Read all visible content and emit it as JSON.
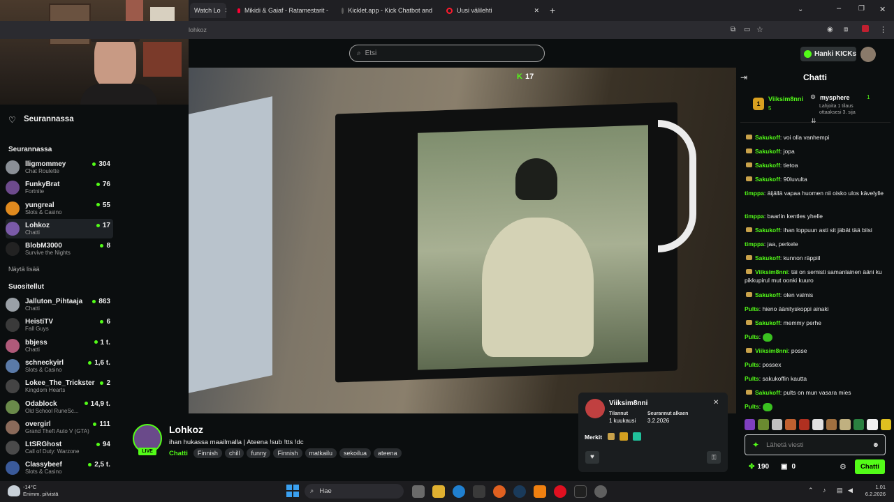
{
  "browser": {
    "tabs": [
      {
        "label": "Watch Lo"
      },
      {
        "label": "Mikidi & Gaiaf - Ratamestarit -"
      },
      {
        "label": "Kicklet.app - Kick Chatbot and"
      },
      {
        "label": "Uusi välilehti"
      }
    ],
    "url": "lohkoz"
  },
  "header": {
    "search_placeholder": "Etsi",
    "cta": "Hanki KICKs"
  },
  "sidebar": {
    "title": "Seurannassa",
    "following_heading": "Seurannassa",
    "following": [
      {
        "name": "lligmommey",
        "cat": "Chat Roulette",
        "count": "304",
        "color": "#8a8f96"
      },
      {
        "name": "FunkyBrat",
        "cat": "Fortnite",
        "count": "76",
        "color": "#6d4a8c"
      },
      {
        "name": "yungreal",
        "cat": "Slots & Casino",
        "count": "55",
        "color": "#e08a1e"
      },
      {
        "name": "Lohkoz",
        "cat": "Chatti",
        "count": "17",
        "color": "#7a5aa8"
      },
      {
        "name": "BlobM3000",
        "cat": "Survive the Nights",
        "count": "8",
        "color": "#222"
      }
    ],
    "show_more": "Näytä lisää",
    "recommended_heading": "Suositellut",
    "recommended": [
      {
        "name": "Jalluton_Pihtaaja",
        "cat": "Chatti",
        "count": "863",
        "color": "#9aa0a6"
      },
      {
        "name": "HeistiTV",
        "cat": "Fall Guys",
        "count": "6",
        "color": "#3a3a3a"
      },
      {
        "name": "bbjess",
        "cat": "Chatti",
        "count": "1 t.",
        "color": "#b05a7a"
      },
      {
        "name": "schneckyirl",
        "cat": "Slots & Casino",
        "count": "1,6 t.",
        "color": "#5a7aa8"
      },
      {
        "name": "Lokee_The_Trickster",
        "cat": "Kingdom Hearts",
        "count": "2",
        "color": "#444"
      },
      {
        "name": "Odablock",
        "cat": "Old School RuneSc...",
        "count": "14,9 t.",
        "color": "#6a8a4a"
      },
      {
        "name": "overgirl",
        "cat": "Grand Theft Auto V (GTA)",
        "count": "111",
        "color": "#8a6a5a"
      },
      {
        "name": "LtSRGhost",
        "cat": "Call of Duty: Warzone",
        "count": "94",
        "color": "#4a4a4a"
      },
      {
        "name": "Classybeef",
        "cat": "Slots & Casino",
        "count": "2,5 t.",
        "color": "#3a5a9a"
      }
    ]
  },
  "player": {
    "viewers": "17"
  },
  "stream": {
    "name": "Lohkoz",
    "title": "ihan hukassa maailmalla | Ateena !sub !tts !dc",
    "category": "Chatti",
    "tags": [
      "Finnish",
      "chill",
      "funny",
      "Finnish",
      "matkailu",
      "sekoilua",
      "ateena"
    ],
    "live": "LIVE"
  },
  "chat": {
    "title": "Chatti",
    "pinned_user": "Viiksim8nni",
    "pinned_count": "5",
    "gift_user": "mysphere",
    "gift_count": "1",
    "gift_text": "Lahjoita 1 tilaus ottaaksesi 3. sija",
    "messages": [
      {
        "u": "Sakukoff",
        "t": "voi olla vanhempi"
      },
      {
        "u": "Sakukoff",
        "t": "jopa"
      },
      {
        "u": "Sakukoff",
        "t": "tietoa"
      },
      {
        "u": "Sakukoff",
        "t": "90luvulta"
      },
      {
        "u": "timppa",
        "t": "äijällä vapaa huomen nii oisko ulos kävelylle"
      },
      {
        "u": "timppa",
        "t": "baarlin kentles yhelle"
      },
      {
        "u": "Sakukoff",
        "t": "ihan loppuun asti sit jäbät tää biisi"
      },
      {
        "u": "timppa",
        "t": "jaa, perkele"
      },
      {
        "u": "Sakukoff",
        "t": "kunnon räppiil"
      },
      {
        "u": "Viiksim8nni",
        "t": "täi on semisti samanlainen ääni ku pikkupirul mut oonki kuuro"
      },
      {
        "u": "Sakukoff",
        "t": "olen valmis"
      },
      {
        "u": "Pults",
        "t": "hieno äänityskoppi ainaki"
      },
      {
        "u": "Sakukoff",
        "t": "memmy perhe"
      },
      {
        "u": "Pults",
        "t": ""
      },
      {
        "u": "Viiksim8nni",
        "t": "posse"
      },
      {
        "u": "Pults",
        "t": "possex"
      },
      {
        "u": "Pults",
        "t": "sakukoffin kautta"
      },
      {
        "u": "Sakukoff",
        "t": "pults on mun vasara mies"
      },
      {
        "u": "Pults",
        "t": ""
      }
    ],
    "input_placeholder": "Lähetä viesti",
    "points": "190",
    "gifts": "0",
    "send": "Chatti"
  },
  "popup": {
    "user": "Viiksim8nni",
    "sub_label": "Tilannut",
    "sub_value": "1 kuukausi",
    "follow_label": "Seurannut alkaen",
    "follow_value": "3.2.2026",
    "badges_label": "Merkit"
  },
  "taskbar": {
    "weather_temp": "-14°C",
    "weather_desc": "Enimm. pilvistä",
    "search": "Hae",
    "time": "1.01",
    "date": "6.2.2026"
  }
}
